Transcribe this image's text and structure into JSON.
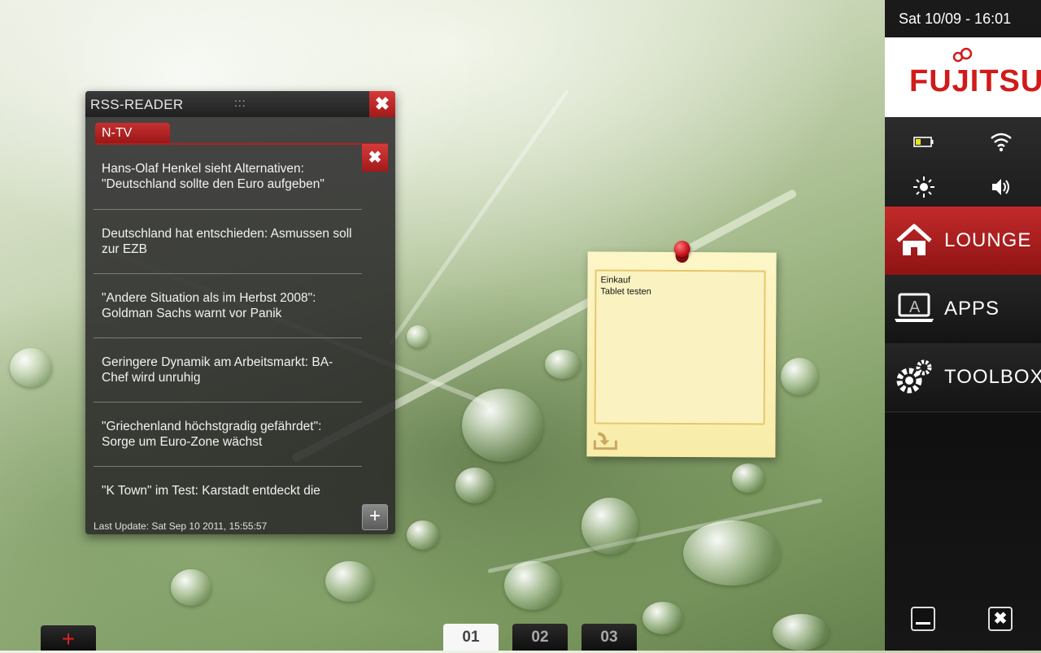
{
  "rss_reader": {
    "title": "RSS-READER",
    "grip": ":::",
    "active_tab": "N-TV",
    "items": [
      "Hans-Olaf Henkel sieht Alternativen: \"Deutschland sollte den Euro aufgeben\"",
      "Deutschland hat entschieden: Asmussen soll zur EZB",
      "\"Andere Situation als im Herbst 2008\": Goldman Sachs warnt vor Panik",
      "Geringere Dynamik am Arbeitsmarkt: BA-Chef wird unruhig",
      "\"Griechenland höchstgradig gefährdet\": Sorge um Euro-Zone wächst",
      "\"K Town\" im Test: Karstadt entdeckt die"
    ],
    "last_update": "Last Update: Sat Sep 10 2011, 15:55:57"
  },
  "sticky_note": {
    "text": "Einkauf\nTablet testen"
  },
  "sidebar": {
    "clock": "Sat 10/09 - 16:01",
    "brand": "FUJITSU",
    "nav": [
      {
        "label": "LOUNGE",
        "icon": "home-icon",
        "active": true
      },
      {
        "label": "APPS",
        "icon": "laptop-icon",
        "active": false
      },
      {
        "label": "TOOLBOX",
        "icon": "gears-icon",
        "active": false
      }
    ],
    "status_icons": [
      "battery-icon",
      "wifi-icon",
      "brightness-icon",
      "volume-icon"
    ]
  },
  "bottom": {
    "add_label": "+",
    "pages": [
      "01",
      "02",
      "03"
    ],
    "active_page": "01"
  },
  "colors": {
    "accent_red": "#c32a2a",
    "note_yellow": "#fdf6c7"
  }
}
